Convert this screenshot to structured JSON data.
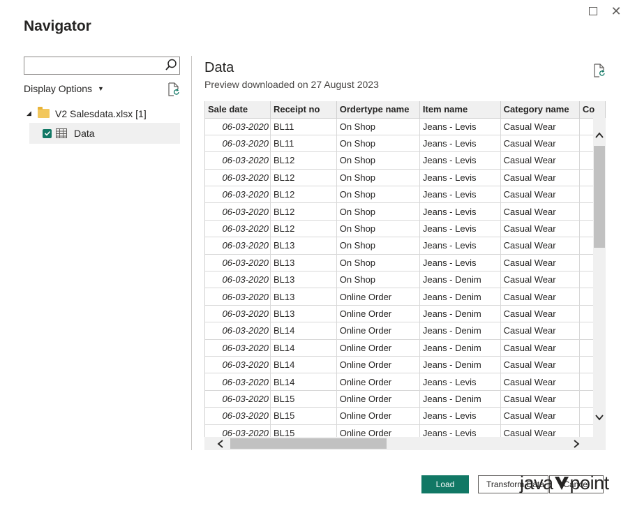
{
  "window": {
    "title": "Navigator"
  },
  "search": {
    "value": "",
    "placeholder": ""
  },
  "left_panel": {
    "display_options_label": "Display Options",
    "tree": {
      "file_label": "V2 Salesdata.xlsx [1]",
      "item_label": "Data",
      "item_checked": true
    }
  },
  "preview": {
    "title": "Data",
    "subtitle": "Preview downloaded on 27 August 2023",
    "columns": [
      "Sale date",
      "Receipt no",
      "Ordertype name",
      "Item name",
      "Category name",
      "Co"
    ],
    "rows": [
      [
        "06-03-2020",
        "BL11",
        "On Shop",
        "Jeans - Levis",
        "Casual Wear"
      ],
      [
        "06-03-2020",
        "BL11",
        "On Shop",
        "Jeans - Levis",
        "Casual Wear"
      ],
      [
        "06-03-2020",
        "BL12",
        "On Shop",
        "Jeans - Levis",
        "Casual Wear"
      ],
      [
        "06-03-2020",
        "BL12",
        "On Shop",
        "Jeans - Levis",
        "Casual Wear"
      ],
      [
        "06-03-2020",
        "BL12",
        "On Shop",
        "Jeans - Levis",
        "Casual Wear"
      ],
      [
        "06-03-2020",
        "BL12",
        "On Shop",
        "Jeans - Levis",
        "Casual Wear"
      ],
      [
        "06-03-2020",
        "BL12",
        "On Shop",
        "Jeans - Levis",
        "Casual Wear"
      ],
      [
        "06-03-2020",
        "BL13",
        "On Shop",
        "Jeans - Levis",
        "Casual Wear"
      ],
      [
        "06-03-2020",
        "BL13",
        "On Shop",
        "Jeans - Levis",
        "Casual Wear"
      ],
      [
        "06-03-2020",
        "BL13",
        "On Shop",
        "Jeans - Denim",
        "Casual Wear"
      ],
      [
        "06-03-2020",
        "BL13",
        "Online Order",
        "Jeans - Denim",
        "Casual Wear"
      ],
      [
        "06-03-2020",
        "BL13",
        "Online Order",
        "Jeans - Denim",
        "Casual Wear"
      ],
      [
        "06-03-2020",
        "BL14",
        "Online Order",
        "Jeans - Denim",
        "Casual Wear"
      ],
      [
        "06-03-2020",
        "BL14",
        "Online Order",
        "Jeans - Denim",
        "Casual Wear"
      ],
      [
        "06-03-2020",
        "BL14",
        "Online Order",
        "Jeans - Denim",
        "Casual Wear"
      ],
      [
        "06-03-2020",
        "BL14",
        "Online Order",
        "Jeans - Levis",
        "Casual Wear"
      ],
      [
        "06-03-2020",
        "BL15",
        "Online Order",
        "Jeans - Denim",
        "Casual Wear"
      ],
      [
        "06-03-2020",
        "BL15",
        "Online Order",
        "Jeans - Levis",
        "Casual Wear"
      ],
      [
        "06-03-2020",
        "BL15",
        "Online Order",
        "Jeans - Levis",
        "Casual Wear"
      ]
    ]
  },
  "buttons": {
    "load": "Load",
    "transform": "Transform Data",
    "cancel": "Cancel"
  },
  "watermark": {
    "left": "java",
    "right": "point"
  },
  "colors": {
    "accent": "#117865",
    "folder": "#f2c75c",
    "header_bg": "#f0f0f0"
  }
}
